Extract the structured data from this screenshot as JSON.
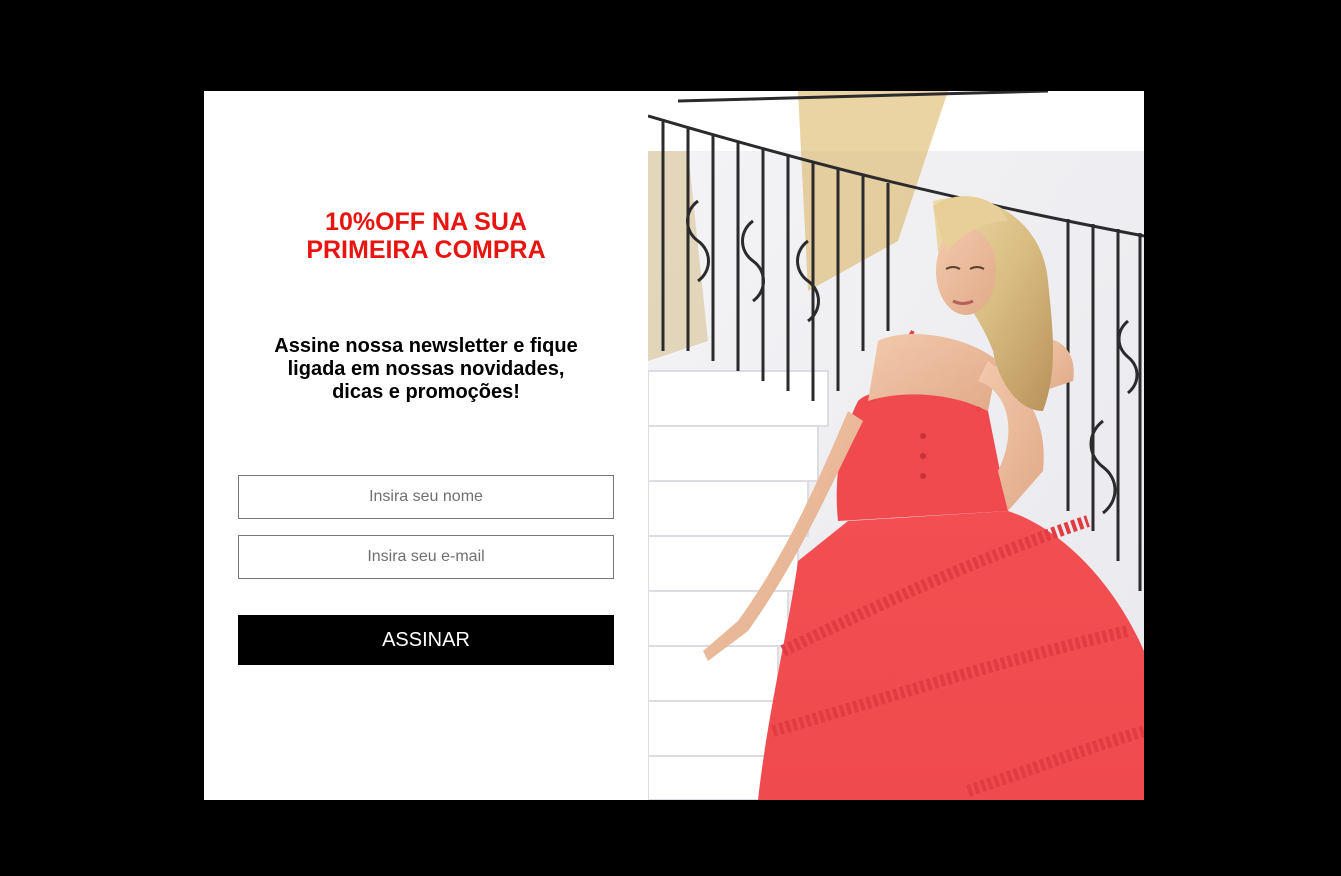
{
  "popup": {
    "headline": [
      "10%OFF NA SUA",
      "PRIMEIRA COMPRA"
    ],
    "subtitle": [
      "Assine nossa newsletter e fique",
      "ligada em nossas novidades,",
      "dicas e promoções!"
    ],
    "form": {
      "name_placeholder": "Insira seu nome",
      "email_placeholder": "Insira seu e-mail",
      "submit_label": "ASSINAR"
    },
    "image": {
      "subject": "woman-in-red-dress-on-staircase"
    },
    "colors": {
      "backdrop": "#000000",
      "headline": "#e8140f",
      "button_bg": "#000000",
      "button_text": "#ffffff",
      "dress": "#f0504f"
    }
  }
}
